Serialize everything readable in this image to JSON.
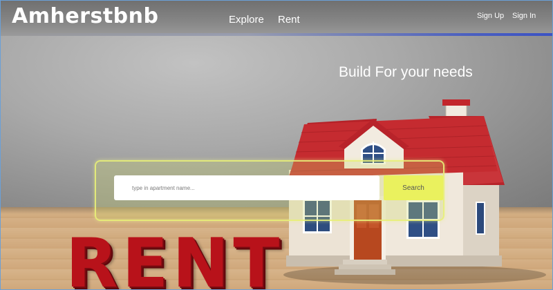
{
  "header": {
    "brand": "Amherstbnb",
    "nav": [
      {
        "label": "Explore"
      },
      {
        "label": "Rent"
      }
    ],
    "auth": {
      "signup": "Sign Up",
      "signin": "Sign In"
    }
  },
  "hero": {
    "tagline": "Build For your needs",
    "search": {
      "placeholder": "type in apartment name...",
      "value": "",
      "button_label": "Search"
    },
    "sign_text": "RENT"
  },
  "colors": {
    "accent": "#eaf15e",
    "sign_red": "#b8121a",
    "roof_red": "#c0262a",
    "header_rule": "#3b52c4"
  }
}
